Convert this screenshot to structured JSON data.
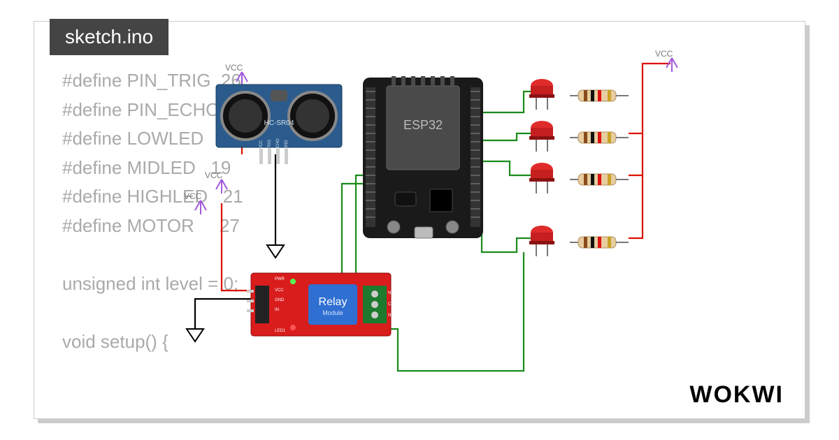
{
  "tab": {
    "filename": "sketch.ino"
  },
  "code": {
    "lines": [
      "#define PIN_TRIG  26",
      "#define PIN_ECHO",
      "#define LOWLED",
      "#define MIDLED   19",
      "#define HIGHLED   21",
      "#define MOTOR     27",
      "",
      "unsigned int level = 0;",
      "",
      "void setup() {"
    ]
  },
  "components": {
    "ultrasonic": {
      "label": "HC-SR04",
      "pins": [
        "VCC",
        "TRIG",
        "ECHO",
        "GND"
      ]
    },
    "mcu": {
      "label": "ESP32"
    },
    "relay": {
      "label": "Relay",
      "sub": "Module",
      "pins_left": [
        "VCC",
        "GND",
        "IN"
      ],
      "pins_side": [
        "PWR",
        "LED1"
      ],
      "pins_right": [
        "NO",
        "COM",
        "NC"
      ]
    },
    "led_count": 4
  },
  "labels": {
    "vcc": "VCC"
  },
  "brand": "WOKWI"
}
